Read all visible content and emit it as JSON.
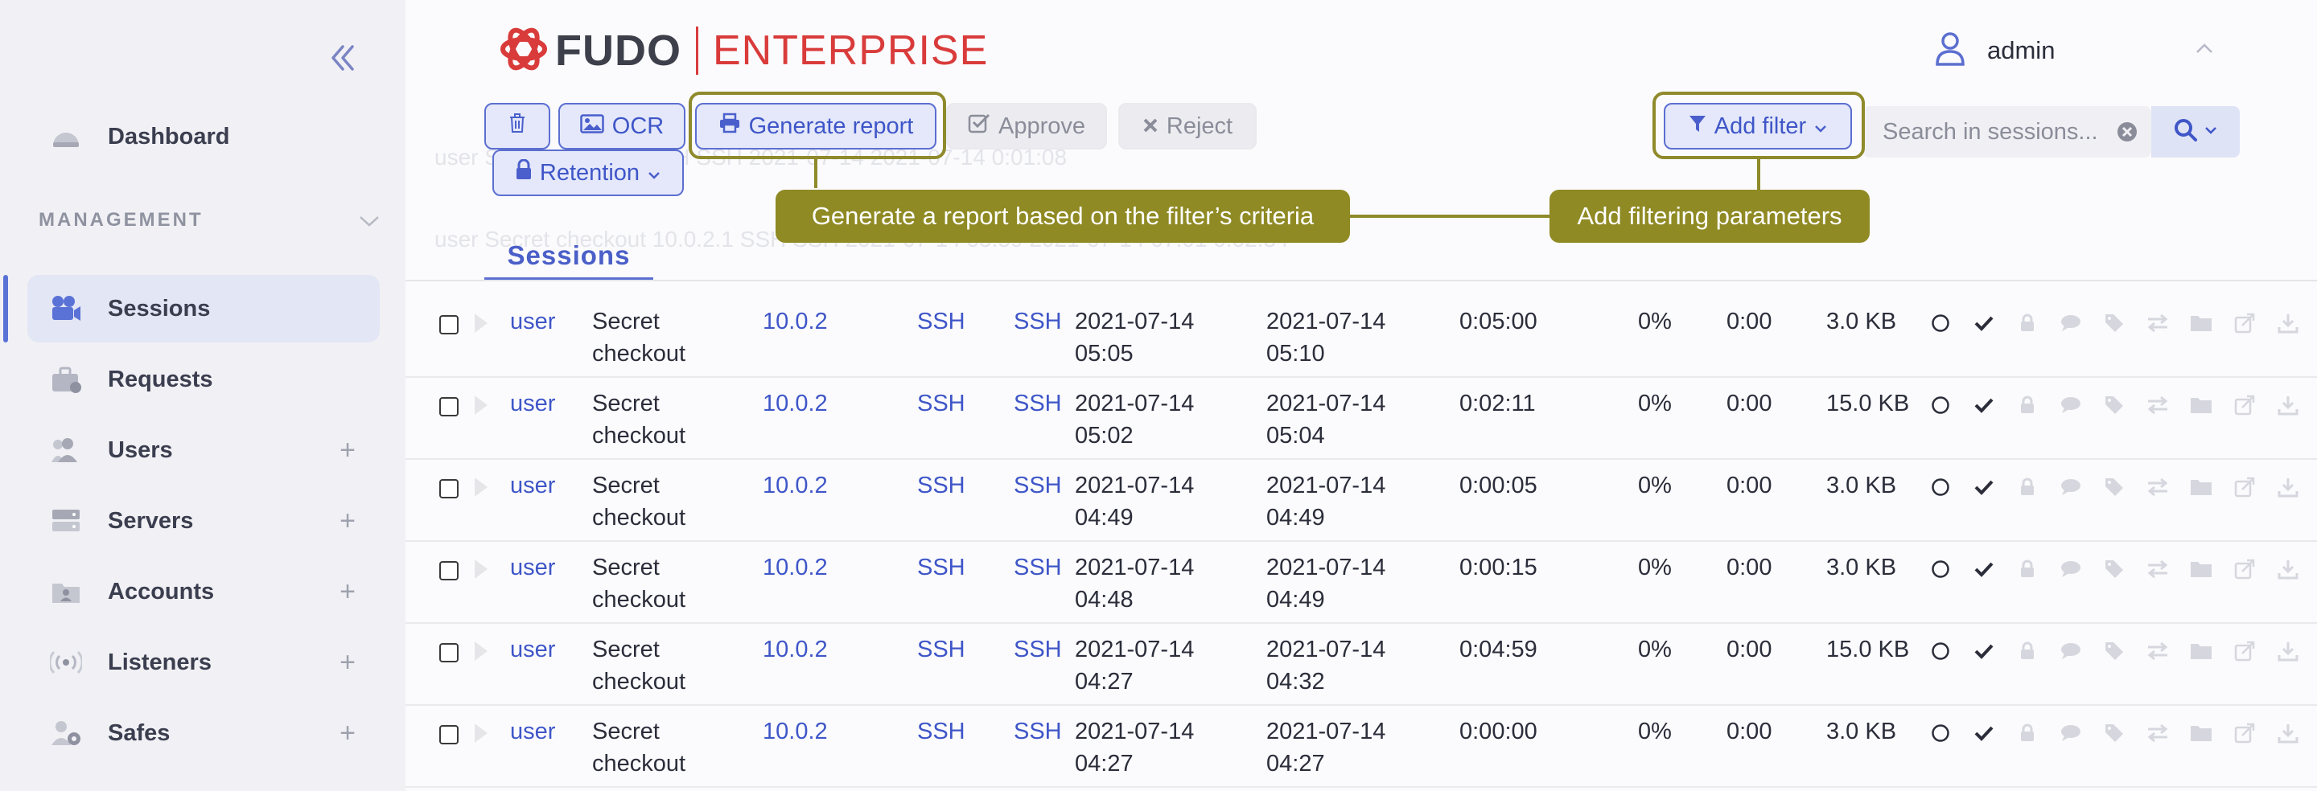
{
  "sidebar": {
    "collapse_icon": "double-chevron-left-icon",
    "dashboard": "Dashboard",
    "section": "MANAGEMENT",
    "items": [
      {
        "label": "Sessions",
        "icon": "camera-icon",
        "has_plus": false
      },
      {
        "label": "Requests",
        "icon": "briefcase-icon",
        "has_plus": false
      },
      {
        "label": "Users",
        "icon": "users-icon",
        "has_plus": true
      },
      {
        "label": "Servers",
        "icon": "server-icon",
        "has_plus": true
      },
      {
        "label": "Accounts",
        "icon": "account-folder-icon",
        "has_plus": true
      },
      {
        "label": "Listeners",
        "icon": "broadcast-icon",
        "has_plus": true
      },
      {
        "label": "Safes",
        "icon": "user-safe-icon",
        "has_plus": true
      }
    ],
    "plus": "+"
  },
  "header": {
    "brand": "FUDO",
    "edition": "ENTERPRISE",
    "username": "admin"
  },
  "toolbar": {
    "delete_icon": "trash-icon",
    "ocr": "OCR",
    "generate_report": "Generate report",
    "approve": "Approve",
    "reject": "Reject",
    "retention": "Retention",
    "add_filter": "Add filter",
    "search_placeholder": "Search in sessions..."
  },
  "tooltips": {
    "report": "Generate a report based on the filter’s criteria",
    "filter": "Add filtering parameters"
  },
  "tabs": {
    "sessions": "Sessions"
  },
  "ghost_rows": [
    "user    Secret    10.0.2.1    SSH    SSH    2021-07-14    2021-07-14    0:01:08",
    "user    Secret checkout    10.0.2.1    SSH    SSH    2021-07-14 05:59    2021-07-14 07:01    0:02:34"
  ],
  "rows": [
    {
      "user": "user",
      "safe1": "Secret",
      "safe2": "checkout",
      "ip": "10.0.2",
      "proto": "SSH",
      "srv": "SSH",
      "start_date": "2021-07-14",
      "start_time": "05:05",
      "end_date": "2021-07-14",
      "end_time": "05:10",
      "duration": "0:05:00",
      "pct": "0%",
      "idle": "0:00",
      "size": "3.0 KB"
    },
    {
      "user": "user",
      "safe1": "Secret",
      "safe2": "checkout",
      "ip": "10.0.2",
      "proto": "SSH",
      "srv": "SSH",
      "start_date": "2021-07-14",
      "start_time": "05:02",
      "end_date": "2021-07-14",
      "end_time": "05:04",
      "duration": "0:02:11",
      "pct": "0%",
      "idle": "0:00",
      "size": "15.0 KB"
    },
    {
      "user": "user",
      "safe1": "Secret",
      "safe2": "checkout",
      "ip": "10.0.2",
      "proto": "SSH",
      "srv": "SSH",
      "start_date": "2021-07-14",
      "start_time": "04:49",
      "end_date": "2021-07-14",
      "end_time": "04:49",
      "duration": "0:00:05",
      "pct": "0%",
      "idle": "0:00",
      "size": "3.0 KB"
    },
    {
      "user": "user",
      "safe1": "Secret",
      "safe2": "checkout",
      "ip": "10.0.2",
      "proto": "SSH",
      "srv": "SSH",
      "start_date": "2021-07-14",
      "start_time": "04:48",
      "end_date": "2021-07-14",
      "end_time": "04:49",
      "duration": "0:00:15",
      "pct": "0%",
      "idle": "0:00",
      "size": "3.0 KB"
    },
    {
      "user": "user",
      "safe1": "Secret",
      "safe2": "checkout",
      "ip": "10.0.2",
      "proto": "SSH",
      "srv": "SSH",
      "start_date": "2021-07-14",
      "start_time": "04:27",
      "end_date": "2021-07-14",
      "end_time": "04:32",
      "duration": "0:04:59",
      "pct": "0%",
      "idle": "0:00",
      "size": "15.0 KB"
    },
    {
      "user": "user",
      "safe1": "Secret",
      "safe2": "checkout",
      "ip": "10.0.2",
      "proto": "SSH",
      "srv": "SSH",
      "start_date": "2021-07-14",
      "start_time": "04:27",
      "end_date": "2021-07-14",
      "end_time": "04:27",
      "duration": "0:00:00",
      "pct": "0%",
      "idle": "0:00",
      "size": "3.0 KB"
    }
  ],
  "row_action_icons": [
    "circle-icon",
    "check-icon",
    "lock-icon",
    "comment-icon",
    "tag-icon",
    "transfer-icon",
    "folder-icon",
    "share-icon",
    "download-icon"
  ],
  "colors": {
    "accent": "#5c6fd0",
    "brand_red": "#d93b3b",
    "tooltip": "#8f8a24"
  }
}
